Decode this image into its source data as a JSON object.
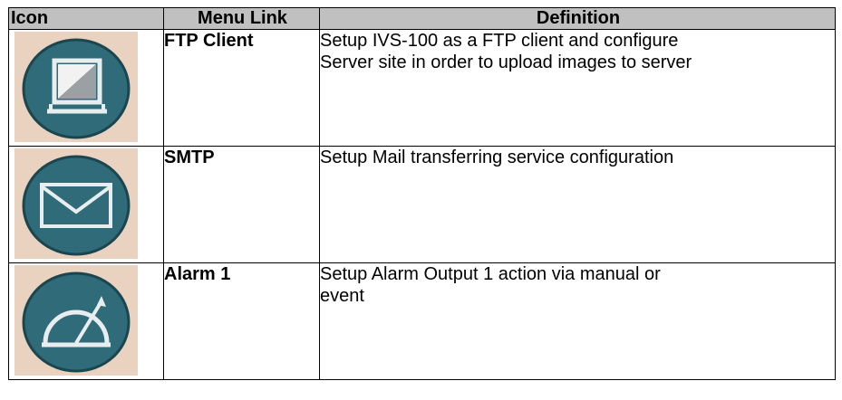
{
  "table": {
    "headers": {
      "icon": "Icon",
      "link": "Menu Link",
      "definition": "Definition"
    },
    "rows": [
      {
        "icon": "ftp-client-icon",
        "link": "FTP Client",
        "definition_lines": [
          "Setup IVS-100 as a FTP client and configure",
          "Server site in order to upload images to server"
        ]
      },
      {
        "icon": "mail-envelope-icon",
        "link": "SMTP",
        "definition_lines": [
          "Setup Mail transferring service configuration"
        ]
      },
      {
        "icon": "alarm-gauge-icon",
        "link": "Alarm 1",
        "definition_lines": [
          "Setup Alarm Output 1 action via manual or",
          "event"
        ]
      }
    ]
  },
  "colors": {
    "header_bg": "#c0c0c0",
    "icon_bg": "#e9d2bf",
    "icon_button": "#2f6b78",
    "icon_glyph": "#e8eef0"
  }
}
